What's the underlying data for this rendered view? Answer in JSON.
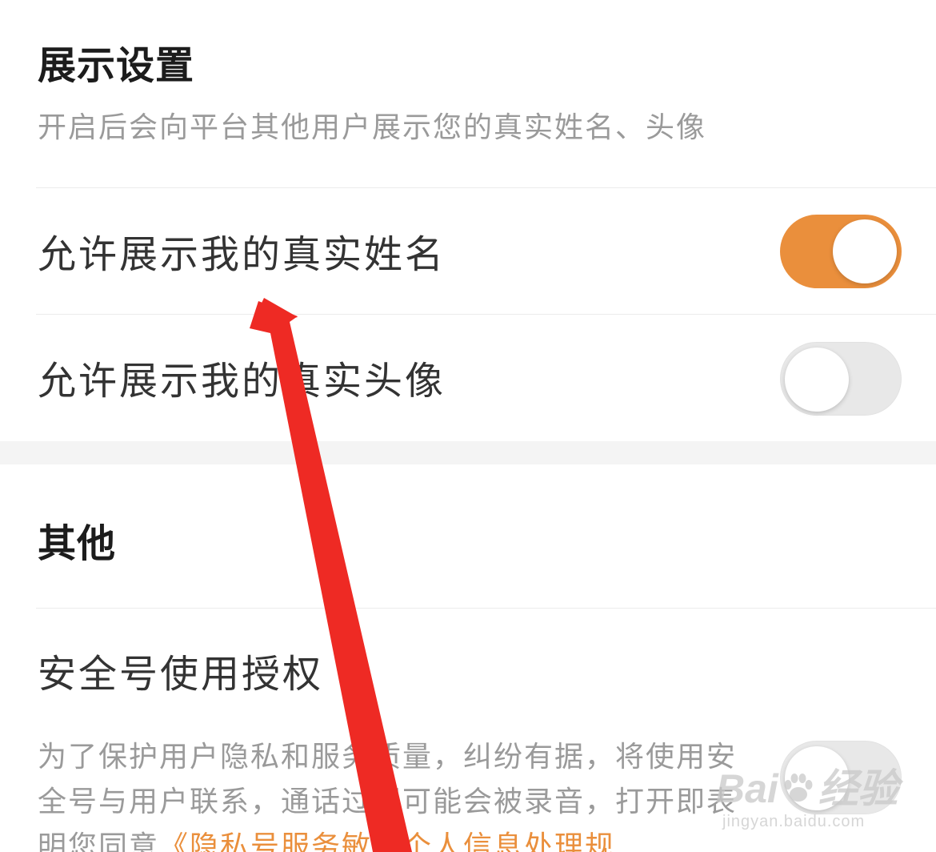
{
  "display_settings": {
    "title": "展示设置",
    "subtitle": "开启后会向平台其他用户展示您的真实姓名、头像",
    "rows": [
      {
        "label": "允许展示我的真实姓名",
        "enabled": true
      },
      {
        "label": "允许展示我的真实头像",
        "enabled": false
      }
    ]
  },
  "other": {
    "title": "其他",
    "security_number": {
      "label": "安全号使用授权",
      "description": "为了保护用户隐私和服务质量，纠纷有据，将使用安全号与用户联系，通话过程可能会被录音，打开即表明您同意",
      "link_text": "《隐私号服务敏感个人信息处理规",
      "enabled": false
    }
  },
  "watermark": {
    "brand_left": "Bai",
    "brand_right": "经验",
    "url": "jingyan.baidu.com"
  },
  "colors": {
    "accent": "#ea8f3c",
    "toggle_off": "#e8e8e8",
    "annotation_arrow": "#ee2a24"
  }
}
